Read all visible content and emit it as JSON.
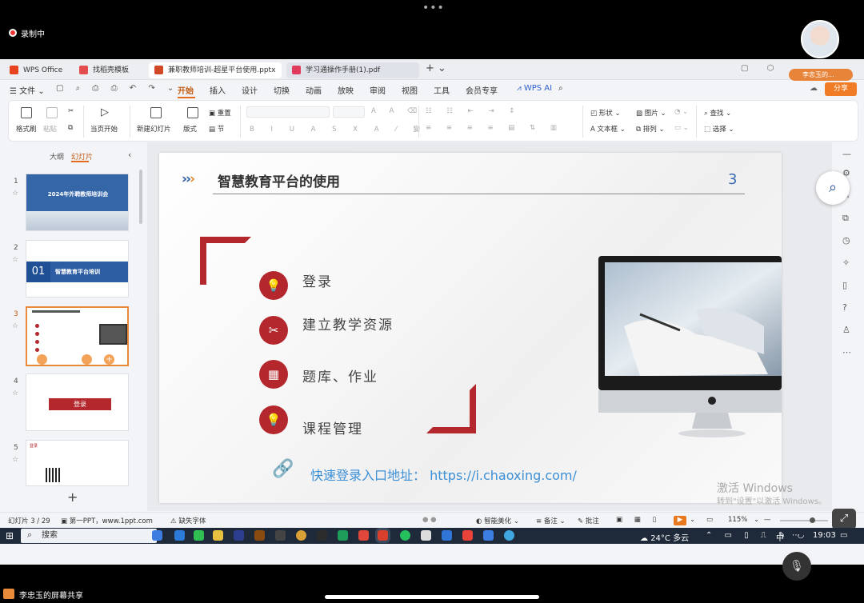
{
  "meeting": {
    "recording_label": "录制中",
    "more_icon": "•••",
    "screen_share_label": "李忠玉的屏幕共享",
    "user_badge": "李忠玉的..."
  },
  "tabs": [
    {
      "label": "WPS Office",
      "icon_color": "#e8421e"
    },
    {
      "label": "找稻壳模板",
      "icon_color": "#e34d4d"
    },
    {
      "label": "兼职教师培训-超星平台使用.pptx",
      "icon_color": "#d24726"
    },
    {
      "label": "学习通操作手册(1).pdf",
      "icon_color": "#e03a5c"
    }
  ],
  "menu": {
    "file": "文件",
    "items": [
      "开始",
      "插入",
      "设计",
      "切换",
      "动画",
      "放映",
      "审阅",
      "视图",
      "工具",
      "会员专享"
    ],
    "wps_ai": "WPS AI",
    "share": "分享"
  },
  "ribbon": {
    "format_painter": "格式刷",
    "paste": "粘贴",
    "from_current": "当页开始",
    "new_slide": "新建幻灯片",
    "layout": "版式",
    "reset": "重置",
    "section": "节",
    "shape": "形状",
    "picture": "图片",
    "textbox": "文本框",
    "arrange": "排列",
    "find": "查找",
    "select": "选择"
  },
  "left_pane": {
    "outline_tab": "大纲",
    "slides_tab": "幻灯片",
    "thumbs": [
      {
        "num": "1",
        "title": "2024年外聘教师培训会"
      },
      {
        "num": "2",
        "badge": "01",
        "title": "智慧教育平台培训"
      },
      {
        "num": "3"
      },
      {
        "num": "4",
        "title": "登录"
      },
      {
        "num": "5",
        "title": "登录"
      }
    ]
  },
  "slide": {
    "chevrons": "›››",
    "title": "智慧教育平台的使用",
    "number": "3",
    "bullets": [
      {
        "icon": "💡",
        "text": "登录"
      },
      {
        "icon": "✂",
        "text": "建立教学资源"
      },
      {
        "icon": "▦",
        "text": "题库、作业"
      },
      {
        "icon": "💡",
        "text": "课程管理"
      }
    ],
    "link_label": "快速登录入口地址：",
    "link_url": "https://i.chaoxing.com/",
    "watermark_line1": "激活 Windows",
    "watermark_line2": "转到\"设置\"以激活 Windows。"
  },
  "status": {
    "slide_count": "幻灯片 3 / 29",
    "theme": "第一PPT，www.1ppt.com",
    "missing_font": "缺失字体",
    "beautify": "智能美化",
    "notes": "备注",
    "comments": "批注",
    "zoom": "115%"
  },
  "taskbar": {
    "search": "搜索",
    "weather": "24°C 多云",
    "ime": "中",
    "time": "19:03"
  }
}
